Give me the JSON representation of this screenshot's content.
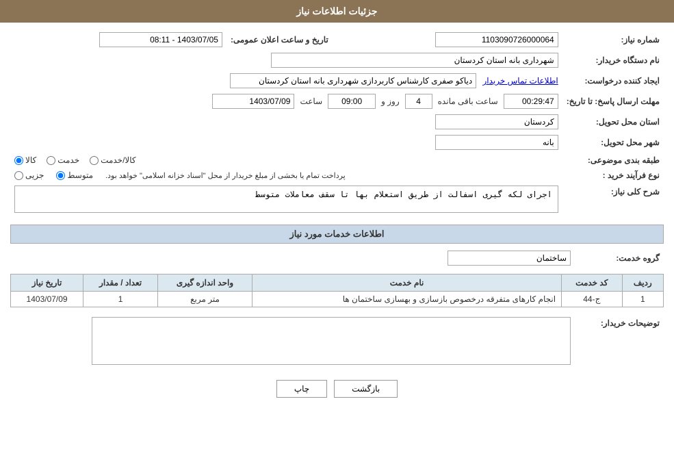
{
  "header": {
    "title": "جزئیات اطلاعات نیاز"
  },
  "fields": {
    "request_number_label": "شماره نیاز:",
    "request_number_value": "1103090726000064",
    "announcement_date_label": "تاریخ و ساعت اعلان عمومی:",
    "announcement_date_value": "1403/07/05 - 08:11",
    "buyer_org_label": "نام دستگاه خریدار:",
    "buyer_org_value": "شهرداری بانه استان کردستان",
    "creator_label": "ایجاد کننده درخواست:",
    "creator_value": "دیاکو صفری کارشناس کاربردازی شهرداری بانه استان کردستان",
    "creator_link": "اطلاعات تماس خریدار",
    "deadline_label": "مهلت ارسال پاسخ: تا تاریخ:",
    "deadline_date": "1403/07/09",
    "deadline_time_label": "ساعت",
    "deadline_time": "09:00",
    "deadline_days_label": "روز و",
    "deadline_days": "4",
    "deadline_remaining_label": "ساعت باقی مانده",
    "deadline_remaining": "00:29:47",
    "delivery_province_label": "استان محل تحویل:",
    "delivery_province_value": "کردستان",
    "delivery_city_label": "شهر محل تحویل:",
    "delivery_city_value": "بانه",
    "category_label": "طبقه بندی موضوعی:",
    "category_kala": "کالا",
    "category_khedmat": "خدمت",
    "category_kala_khedmat": "کالا/خدمت",
    "process_label": "نوع فرآیند خرید :",
    "process_jezii": "جزیی",
    "process_motavaset": "متوسط",
    "process_description": "پرداخت تمام یا بخشی از مبلغ خریدار از محل \"اسناد خزانه اسلامی\" خواهد بود.",
    "description_label": "شرح کلی نیاز:",
    "description_value": "اجرای لکه گیری اسفالت از طریق استعلام بها تا سقف معاملات متوسط",
    "services_section_label": "اطلاعات خدمات مورد نیاز",
    "service_group_label": "گروه خدمت:",
    "service_group_value": "ساختمان",
    "table_headers": {
      "row_num": "ردیف",
      "service_code": "کد خدمت",
      "service_name": "نام خدمت",
      "unit": "واحد اندازه گیری",
      "quantity": "تعداد / مقدار",
      "date": "تاریخ نیاز"
    },
    "table_rows": [
      {
        "row_num": "1",
        "service_code": "ج-44",
        "service_name": "انجام کارهای متفرقه درخصوص بازسازی و بهسازی ساختمان ها",
        "unit": "متر مربع",
        "quantity": "1",
        "date": "1403/07/09"
      }
    ],
    "buyer_notes_label": "توضیحات خریدار:",
    "buyer_notes_value": "",
    "btn_print": "چاپ",
    "btn_back": "بازگشت"
  }
}
